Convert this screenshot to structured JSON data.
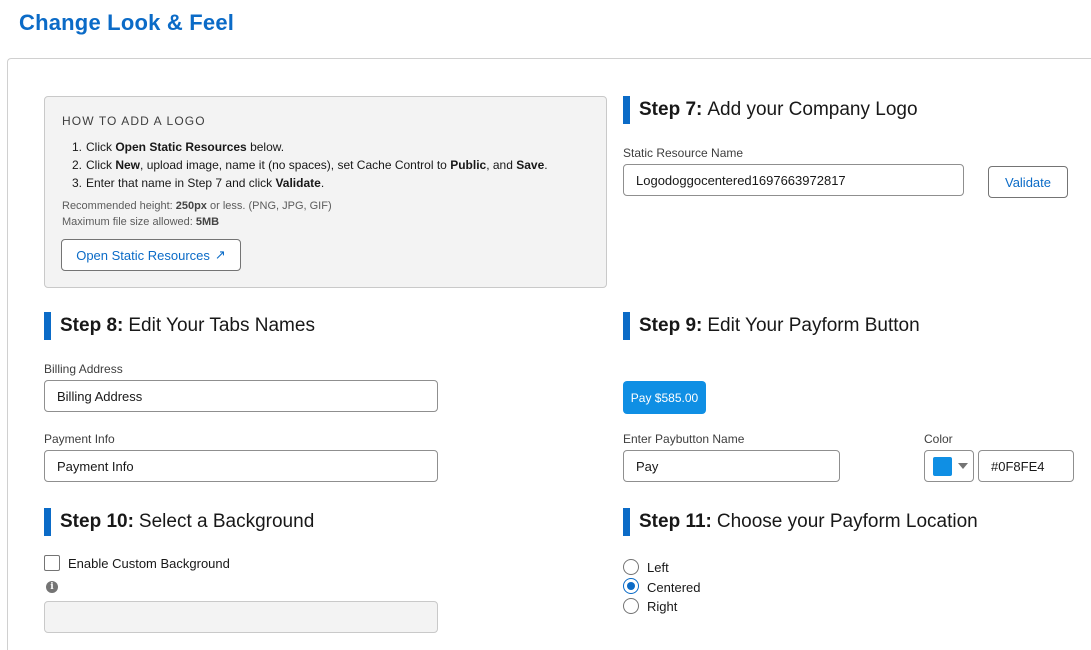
{
  "page": {
    "title": "Change Look & Feel"
  },
  "howto": {
    "title": "HOW TO ADD A LOGO",
    "steps": [
      {
        "num": "1.",
        "t1": "Click ",
        "b1": "Open Static Resources",
        "t2": " below."
      },
      {
        "num": "2.",
        "t1": "Click ",
        "b1": "New",
        "t2": ", upload image, name it (no spaces), set Cache Control to ",
        "b2": "Public",
        "t3": ", and ",
        "b3": "Save",
        "t4": "."
      },
      {
        "num": "3.",
        "t1": "Enter that name in Step 7 and click ",
        "b1": "Validate",
        "t2": "."
      }
    ],
    "height_note": {
      "t1": "Recommended height: ",
      "b1": "250px",
      "t2": " or less. (PNG, JPG, GIF)"
    },
    "size_note": {
      "t1": "Maximum file size allowed: ",
      "b1": "5MB"
    },
    "open_button": "Open Static Resources",
    "open_icon": "↗"
  },
  "step7": {
    "num": "Step 7:",
    "title": "Add your Company Logo",
    "field_label": "Static Resource Name",
    "field_value": "Logodoggocentered1697663972817",
    "validate_label": "Validate"
  },
  "step8": {
    "num": "Step 8:",
    "title": "Edit Your Tabs Names",
    "billing_label": "Billing Address",
    "billing_value": "Billing Address",
    "payment_label": "Payment Info",
    "payment_value": "Payment Info"
  },
  "step9": {
    "num": "Step 9:",
    "title": "Edit Your Payform Button",
    "preview_label": "Pay $585.00",
    "name_label": "Enter Paybutton Name",
    "name_value": "Pay",
    "color_label": "Color",
    "color_value": "#0F8FE4",
    "swatch_color": "#0f8fe4"
  },
  "step10": {
    "num": "Step 10:",
    "title": "Select a Background",
    "checkbox_label": "Enable Custom Background",
    "info_glyph": "i",
    "checked": false
  },
  "step11": {
    "num": "Step 11:",
    "title": "Choose your Payform Location",
    "options": [
      "Left",
      "Centered",
      "Right"
    ],
    "selected": "Centered"
  },
  "colors": {
    "accent": "#0b6bc7",
    "button": "#0f8fe4"
  }
}
